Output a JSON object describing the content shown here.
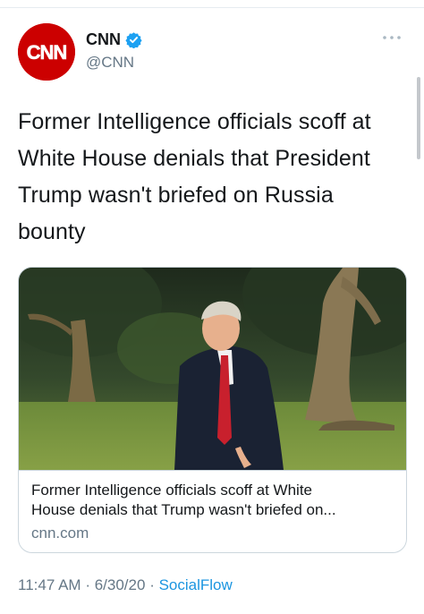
{
  "tweet": {
    "author": {
      "display_name": "CNN",
      "handle": "@CNN",
      "verified": true,
      "avatar_icon": "cnn-logo-icon",
      "avatar_color": "#cc0000"
    },
    "more_icon": "more-horizontal-icon",
    "text_lines": [
      "Former Intelligence officials scoff at",
      "White House denials that President",
      "Trump wasn't briefed on Russia",
      "bounty"
    ],
    "card": {
      "title_lines": [
        "Former Intelligence officials scoff at White",
        "House denials that Trump wasn't briefed on..."
      ],
      "domain": "cnn.com"
    },
    "meta": {
      "time": "11:47 AM",
      "separator": "·",
      "date": "6/30/20",
      "source": "SocialFlow",
      "source_color": "#1b95e0"
    }
  }
}
